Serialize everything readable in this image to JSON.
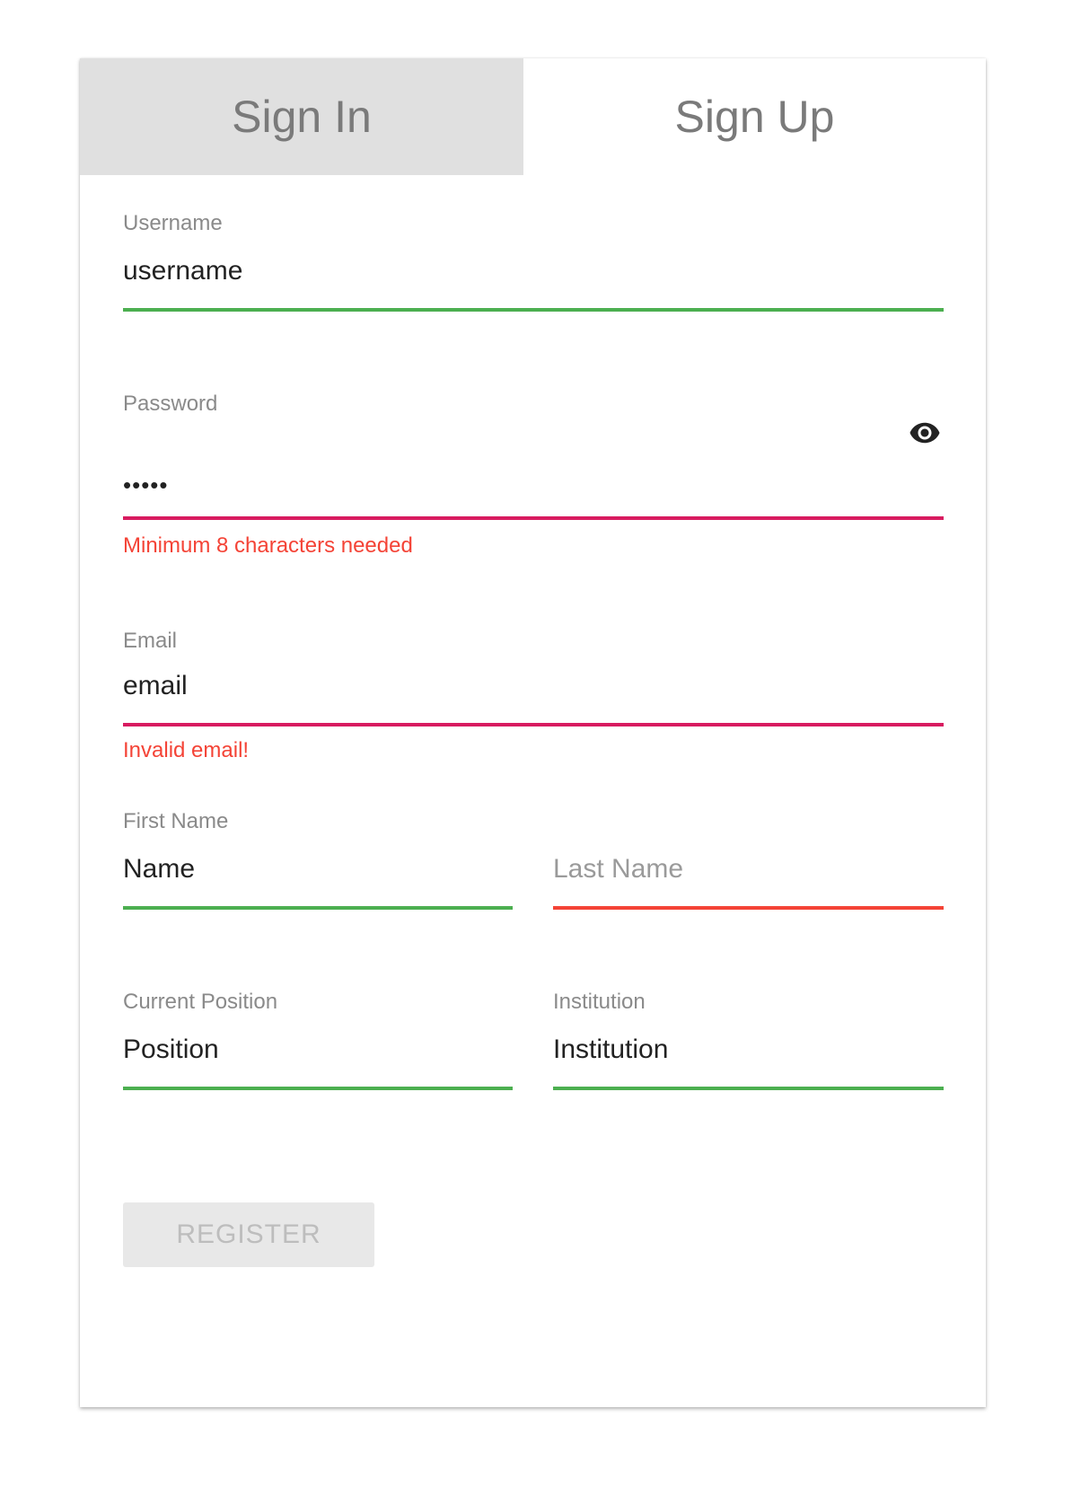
{
  "tabs": {
    "sign_in": "Sign In",
    "sign_up": "Sign Up",
    "active": "sign_up"
  },
  "form": {
    "username": {
      "label": "Username",
      "value": "username"
    },
    "password": {
      "label": "Password",
      "value": "•••••",
      "error": "Minimum 8 characters needed",
      "toggle_icon": "eye-icon"
    },
    "email": {
      "label": "Email",
      "value": "email",
      "error": "Invalid email!"
    },
    "first_name": {
      "label": "First Name",
      "value": "Name"
    },
    "last_name": {
      "placeholder": "Last Name",
      "value": ""
    },
    "position": {
      "label": "Current Position",
      "value": "Position"
    },
    "institution": {
      "label": "Institution",
      "value": "Institution"
    },
    "register_label": "REGISTER"
  },
  "colors": {
    "valid": "#4caf50",
    "invalid": "#d81b60",
    "required": "#f44336",
    "error_text": "#f44336",
    "tab_inactive_bg": "#e0e0e0"
  }
}
